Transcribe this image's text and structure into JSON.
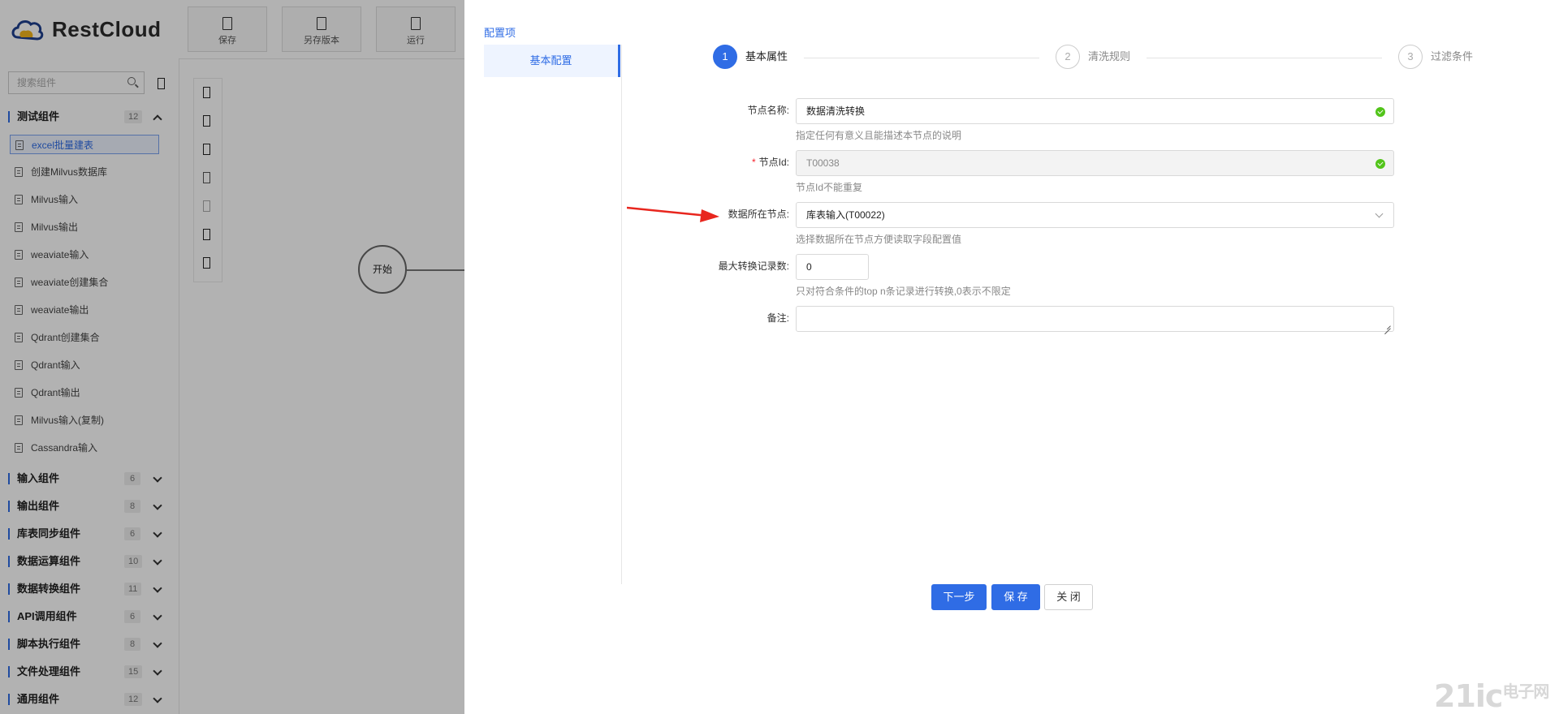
{
  "app": {
    "logo_text": "RestCloud",
    "toolbar": [
      {
        "label": "保存",
        "icon": "save-icon"
      },
      {
        "label": "另存版本",
        "icon": "save-as-icon"
      },
      {
        "label": "运行",
        "icon": "run-icon"
      }
    ],
    "search": {
      "placeholder": "搜索组件"
    },
    "groups": [
      {
        "title": "测试组件",
        "count": "12",
        "expanded": true
      },
      {
        "title": "输入组件",
        "count": "6"
      },
      {
        "title": "输出组件",
        "count": "8"
      },
      {
        "title": "库表同步组件",
        "count": "6"
      },
      {
        "title": "数据运算组件",
        "count": "10"
      },
      {
        "title": "数据转换组件",
        "count": "11"
      },
      {
        "title": "API调用组件",
        "count": "6"
      },
      {
        "title": "脚本执行组件",
        "count": "8"
      },
      {
        "title": "文件处理组件",
        "count": "15"
      },
      {
        "title": "通用组件",
        "count": "12"
      }
    ],
    "test_components": [
      "excel批量建表",
      "创建Milvus数据库",
      "Milvus输入",
      "Milvus输出",
      "weaviate输入",
      "weaviate创建集合",
      "weaviate输出",
      "Qdrant创建集合",
      "Qdrant输入",
      "Qdrant输出",
      "Milvus输入(复制)",
      "Cassandra输入"
    ],
    "canvas": {
      "start_node": "开始"
    }
  },
  "drawer": {
    "section_title": "配置项",
    "tab": "基本配置",
    "steps": [
      {
        "num": "1",
        "label": "基本属性",
        "active": true
      },
      {
        "num": "2",
        "label": "清洗规则"
      },
      {
        "num": "3",
        "label": "过滤条件"
      }
    ],
    "form": {
      "node_name": {
        "label": "节点名称:",
        "value": "数据清洗转换",
        "help": "指定任何有意义且能描述本节点的说明"
      },
      "node_id": {
        "label": "节点Id:",
        "value": "T00038",
        "help": "节点Id不能重复"
      },
      "data_node": {
        "label": "数据所在节点:",
        "value": "库表输入(T00022)",
        "help": "选择数据所在节点方便读取字段配置值"
      },
      "max_records": {
        "label": "最大转换记录数:",
        "value": "0",
        "help": "只对符合条件的top n条记录进行转换,0表示不限定"
      },
      "remark": {
        "label": "备注:",
        "value": ""
      }
    },
    "buttons": {
      "next": "下一步",
      "save": "保 存",
      "close": "关 闭"
    }
  },
  "watermark": {
    "main": "21ic",
    "sub": "电子网"
  },
  "colors": {
    "primary": "#2f6ce5",
    "success": "#52c41a",
    "required": "#f5222d",
    "annotation_arrow": "#e8261e"
  }
}
